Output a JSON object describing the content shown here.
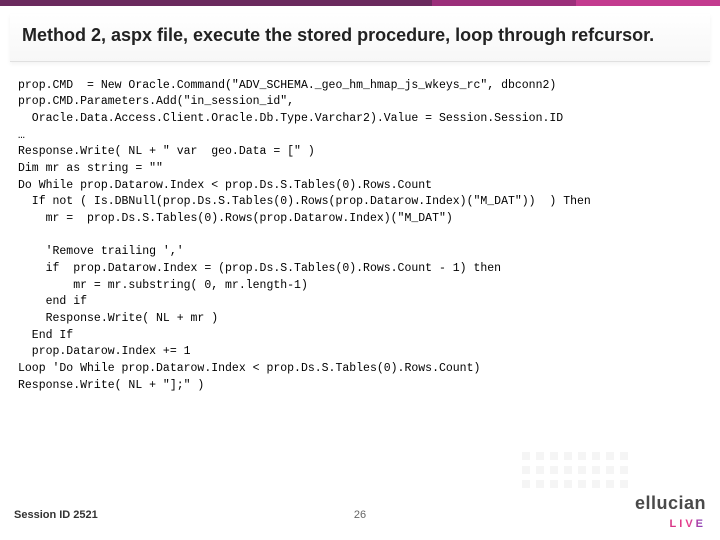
{
  "title": "Method 2, aspx file, execute the stored procedure, loop through refcursor.",
  "code": "prop.CMD  = New Oracle.Command(\"ADV_SCHEMA._geo_hm_hmap_js_wkeys_rc\", dbconn2)\nprop.CMD.Parameters.Add(\"in_session_id\",\n  Oracle.Data.Access.Client.Oracle.Db.Type.Varchar2).Value = Session.Session.ID\n…\nResponse.Write( NL + \" var  geo.Data = [\" )\nDim mr as string = \"\"\nDo While prop.Datarow.Index < prop.Ds.S.Tables(0).Rows.Count\n  If not ( Is.DBNull(prop.Ds.S.Tables(0).Rows(prop.Datarow.Index)(\"M_DAT\"))  ) Then\n    mr =  prop.Ds.S.Tables(0).Rows(prop.Datarow.Index)(\"M_DAT\")\n\n    'Remove trailing ','\n    if  prop.Datarow.Index = (prop.Ds.S.Tables(0).Rows.Count - 1) then\n        mr = mr.substring( 0, mr.length-1)\n    end if\n    Response.Write( NL + mr )\n  End If\n  prop.Datarow.Index += 1\nLoop 'Do While prop.Datarow.Index < prop.Ds.S.Tables(0).Rows.Count)\nResponse.Write( NL + \"];\" )",
  "footer": {
    "session_label": "Session ID 2521",
    "page_number": "26",
    "logo_brand": "ellucian",
    "logo_live": "LIVE"
  }
}
